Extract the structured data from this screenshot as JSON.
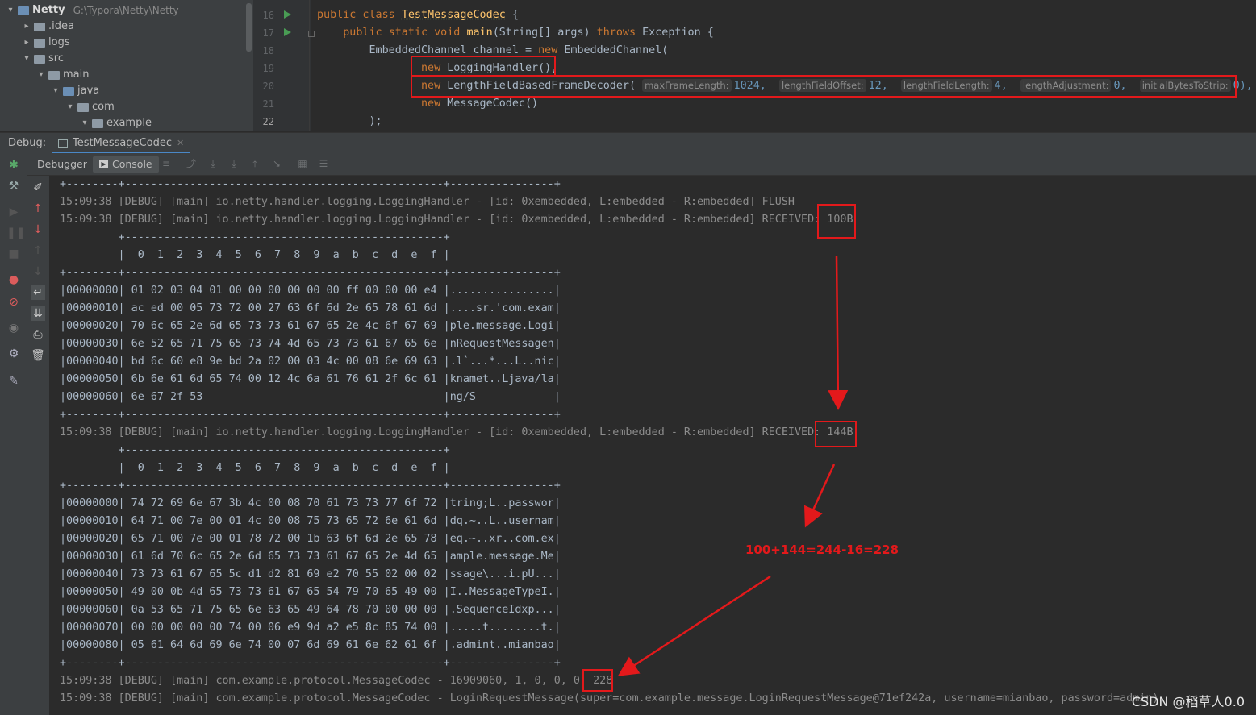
{
  "tree": {
    "project": "Netty",
    "project_path": "G:\\Typora\\Netty\\Netty",
    "items": [
      ".idea",
      "logs",
      "src",
      "main",
      "java",
      "com",
      "example"
    ]
  },
  "editor": {
    "lines": [
      "16",
      "17",
      "18",
      "19",
      "20",
      "21",
      "22"
    ],
    "code": {
      "l16a": "public class ",
      "l16b": "TestMessageCodec",
      " l16c": " {",
      "l17a": "    public static void ",
      "l17b": "main",
      "l17c": "(String[] args) ",
      "l17d": "throws",
      " l17e": " Exception {",
      "l18a": "        EmbeddedChannel channel = ",
      "l18b": "new",
      " l18c": " EmbeddedChannel(",
      "l19a": "                ",
      "l19b": "new",
      " l19c": " LoggingHandler(),",
      "l20a": "                ",
      "l20b": "new",
      " l20c": " LengthFieldBasedFrameDecoder(",
      "l21a": "                ",
      "l21b": "new",
      " l21c": " MessageCodec()",
      "l22a": "        );"
    },
    "hints": {
      "h1": "maxFrameLength:",
      "v1": "1024,",
      "h2": "lengthFieldOffset:",
      "v2": "12,",
      "h3": "lengthFieldLength:",
      "v3": "4,",
      "h4": "lengthAdjustment:",
      "v4": "0,",
      "h5": "initialBytesToStrip:",
      "v5": "0),"
    }
  },
  "debug": {
    "label": "Debug:",
    "tab": "TestMessageCodec",
    "debugger_tab": "Debugger",
    "console_tab": "Console"
  },
  "console": {
    "lines": [
      "+--------+-------------------------------------------------+----------------+",
      "15:09:38 [DEBUG] [main] io.netty.handler.logging.LoggingHandler - [id: 0xembedded, L:embedded - R:embedded] FLUSH",
      "15:09:38 [DEBUG] [main] io.netty.handler.logging.LoggingHandler - [id: 0xembedded, L:embedded - R:embedded] RECEIVED: 100B",
      "         +-------------------------------------------------+",
      "         |  0  1  2  3  4  5  6  7  8  9  a  b  c  d  e  f |",
      "+--------+-------------------------------------------------+----------------+",
      "|00000000| 01 02 03 04 01 00 00 00 00 00 00 ff 00 00 00 e4 |................|",
      "|00000010| ac ed 00 05 73 72 00 27 63 6f 6d 2e 65 78 61 6d |....sr.'com.exam|",
      "|00000020| 70 6c 65 2e 6d 65 73 73 61 67 65 2e 4c 6f 67 69 |ple.message.Logi|",
      "|00000030| 6e 52 65 71 75 65 73 74 4d 65 73 73 61 67 65 6e |nRequestMessagen|",
      "|00000040| bd 6c 60 e8 9e bd 2a 02 00 03 4c 00 08 6e 69 63 |.l`...*...L..nic|",
      "|00000050| 6b 6e 61 6d 65 74 00 12 4c 6a 61 76 61 2f 6c 61 |knamet..Ljava/la|",
      "|00000060| 6e 67 2f 53                                     |ng/S            |",
      "+--------+-------------------------------------------------+----------------+",
      "15:09:38 [DEBUG] [main] io.netty.handler.logging.LoggingHandler - [id: 0xembedded, L:embedded - R:embedded] RECEIVED: 144B",
      "         +-------------------------------------------------+",
      "         |  0  1  2  3  4  5  6  7  8  9  a  b  c  d  e  f |",
      "+--------+-------------------------------------------------+----------------+",
      "|00000000| 74 72 69 6e 67 3b 4c 00 08 70 61 73 73 77 6f 72 |tring;L..passwor|",
      "|00000010| 64 71 00 7e 00 01 4c 00 08 75 73 65 72 6e 61 6d |dq.~..L..usernam|",
      "|00000020| 65 71 00 7e 00 01 78 72 00 1b 63 6f 6d 2e 65 78 |eq.~..xr..com.ex|",
      "|00000030| 61 6d 70 6c 65 2e 6d 65 73 73 61 67 65 2e 4d 65 |ample.message.Me|",
      "|00000040| 73 73 61 67 65 5c d1 d2 81 69 e2 70 55 02 00 02 |ssage\\...i.pU...|",
      "|00000050| 49 00 0b 4d 65 73 73 61 67 65 54 79 70 65 49 00 |I..MessageTypeI.|",
      "|00000060| 0a 53 65 71 75 65 6e 63 65 49 64 78 70 00 00 00 |.SequenceIdxp...|",
      "|00000070| 00 00 00 00 00 74 00 06 e9 9d a2 e5 8c 85 74 00 |.....t........t.|",
      "|00000080| 05 61 64 6d 69 6e 74 00 07 6d 69 61 6e 62 61 6f |.admint..mianbao|",
      "+--------+-------------------------------------------------+----------------+",
      "15:09:38 [DEBUG] [main] com.example.protocol.MessageCodec - 16909060, 1, 0, 0, 0, 228",
      "15:09:38 [DEBUG] [main] com.example.protocol.MessageCodec - LoginRequestMessage(super=com.example.message.LoginRequestMessage@71ef242a, username=mianbao, password=admin)"
    ]
  },
  "annotation": "100+144=244-16=228",
  "watermark": "CSDN @稻草人0.0",
  "colors": {
    "highlight": "#e3191b",
    "keyword": "#cc7832",
    "number": "#6897bb",
    "method": "#ffc66d"
  }
}
